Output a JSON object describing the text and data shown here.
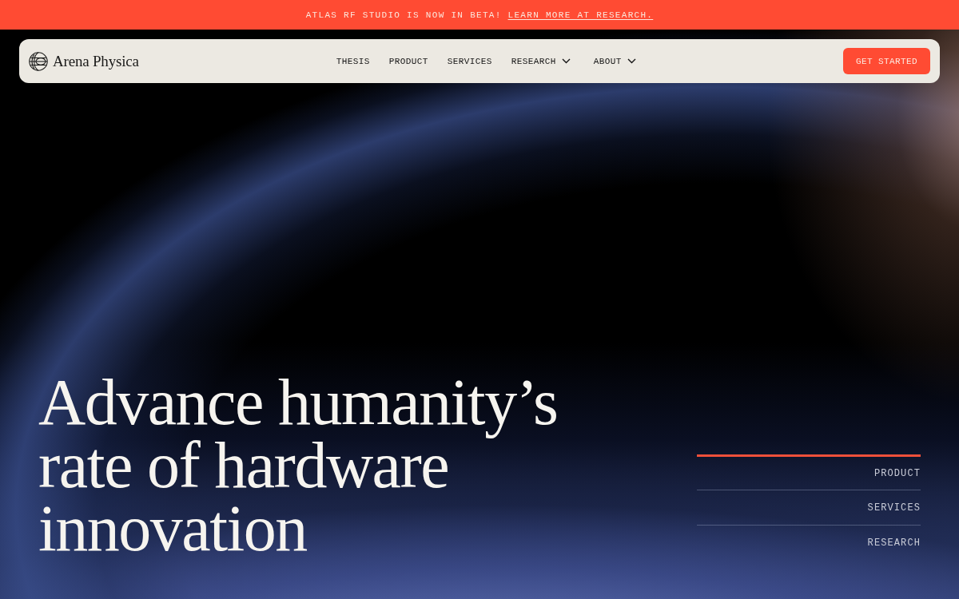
{
  "banner": {
    "text": "ATLAS RF STUDIO IS NOW IN BETA!",
    "link": "LEARN MORE AT RESEARCH."
  },
  "navbar": {
    "logo": "Arena Physica",
    "links": [
      {
        "label": "THESIS",
        "dropdown": false
      },
      {
        "label": "PRODUCT",
        "dropdown": false
      },
      {
        "label": "SERVICES",
        "dropdown": false
      },
      {
        "label": "RESEARCH",
        "dropdown": true
      },
      {
        "label": "ABOUT",
        "dropdown": true
      }
    ],
    "cta": "GET STARTED"
  },
  "hero": {
    "headline": "Advance humanity’s rate of hardware innovation",
    "side_nav": [
      {
        "label": "PRODUCT",
        "selected": true
      },
      {
        "label": "SERVICES",
        "selected": false
      },
      {
        "label": "RESEARCH",
        "selected": false
      }
    ]
  }
}
